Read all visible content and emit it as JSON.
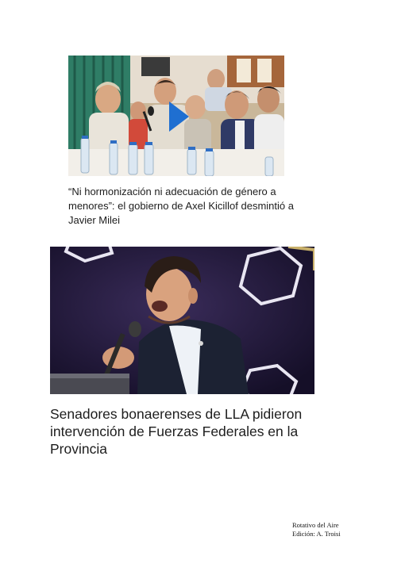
{
  "articles": [
    {
      "image_icon": "video-play-icon",
      "headline": "“Ni hormonización ni adecuación de género a menores”: el gobierno de Axel Kicillof desmintió a Javier Milei"
    },
    {
      "headline": "Senadores bonaerenses de LLA pidieron intervención de Fuerzas Federales en la Provincia"
    }
  ],
  "footer": {
    "line1": "Rotativo del Aire",
    "line2": "Edición: A. Troisi"
  },
  "colors": {
    "play_button": "#1f6fd1",
    "curtain": "#2f7d66",
    "stage_bg": "#1b1430"
  }
}
